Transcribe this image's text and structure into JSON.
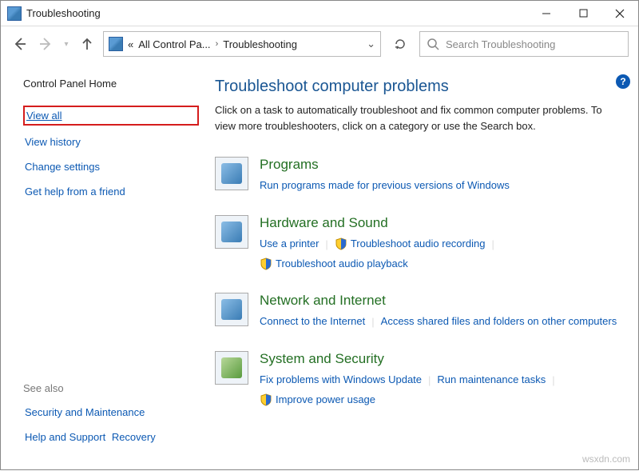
{
  "window": {
    "title": "Troubleshooting"
  },
  "breadcrumb": {
    "panel": "All Control Pa...",
    "current": "Troubleshooting"
  },
  "search": {
    "placeholder": "Search Troubleshooting"
  },
  "sidebar": {
    "home": "Control Panel Home",
    "links": {
      "view_all": "View all",
      "view_history": "View history",
      "change_settings": "Change settings",
      "get_help": "Get help from a friend"
    },
    "see_also_header": "See also",
    "see_also": {
      "security": "Security and Maintenance",
      "help": "Help and Support",
      "recovery": "Recovery"
    }
  },
  "main": {
    "title": "Troubleshoot computer problems",
    "desc": "Click on a task to automatically troubleshoot and fix common computer problems. To view more troubleshooters, click on a category or use the Search box.",
    "categories": {
      "programs": {
        "title": "Programs",
        "link1": "Run programs made for previous versions of Windows"
      },
      "hardware": {
        "title": "Hardware and Sound",
        "use_printer": "Use a printer",
        "audio_rec": "Troubleshoot audio recording",
        "audio_play": "Troubleshoot audio playback"
      },
      "network": {
        "title": "Network and Internet",
        "connect": "Connect to the Internet",
        "shared": "Access shared files and folders on other computers"
      },
      "system": {
        "title": "System and Security",
        "winupdate": "Fix problems with Windows Update",
        "maintenance": "Run maintenance tasks",
        "power": "Improve power usage"
      }
    }
  },
  "watermark": "wsxdn.com"
}
